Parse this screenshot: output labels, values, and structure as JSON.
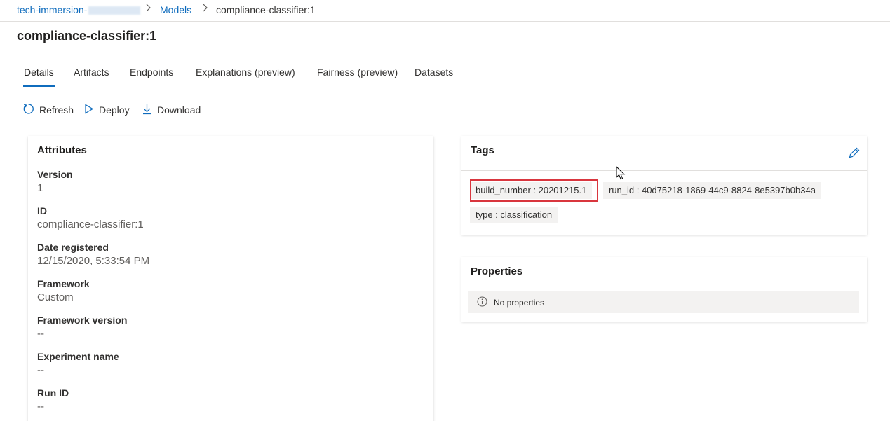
{
  "breadcrumb": {
    "workspace": "tech-immersion-",
    "models": "Models",
    "current": "compliance-classifier:1"
  },
  "page": {
    "title": "compliance-classifier:1"
  },
  "tabs": [
    {
      "label": "Details"
    },
    {
      "label": "Artifacts"
    },
    {
      "label": "Endpoints"
    },
    {
      "label": "Explanations (preview)"
    },
    {
      "label": "Fairness (preview)"
    },
    {
      "label": "Datasets"
    }
  ],
  "toolbar": {
    "refresh": "Refresh",
    "deploy": "Deploy",
    "download": "Download"
  },
  "attributes": {
    "header": "Attributes",
    "items": [
      {
        "label": "Version",
        "value": "1"
      },
      {
        "label": "ID",
        "value": "compliance-classifier:1"
      },
      {
        "label": "Date registered",
        "value": "12/15/2020, 5:33:54 PM"
      },
      {
        "label": "Framework",
        "value": "Custom"
      },
      {
        "label": "Framework version",
        "value": "--"
      },
      {
        "label": "Experiment name",
        "value": "--"
      },
      {
        "label": "Run ID",
        "value": "--"
      }
    ]
  },
  "tags": {
    "header": "Tags",
    "items": [
      {
        "text": "build_number : 20201215.1"
      },
      {
        "text": "run_id : 40d75218-1869-44c9-8824-8e5397b0b34a"
      },
      {
        "text": "type : classification"
      }
    ]
  },
  "properties": {
    "header": "Properties",
    "empty": "No properties"
  },
  "colors": {
    "accent": "#0f6cbd",
    "highlight": "#d9363e",
    "tag_bg": "#f3f2f1"
  },
  "icons": [
    "refresh-icon",
    "play-icon",
    "download-icon",
    "pencil-icon",
    "info-icon",
    "chevron-right-icon",
    "mouse-cursor-icon"
  ]
}
